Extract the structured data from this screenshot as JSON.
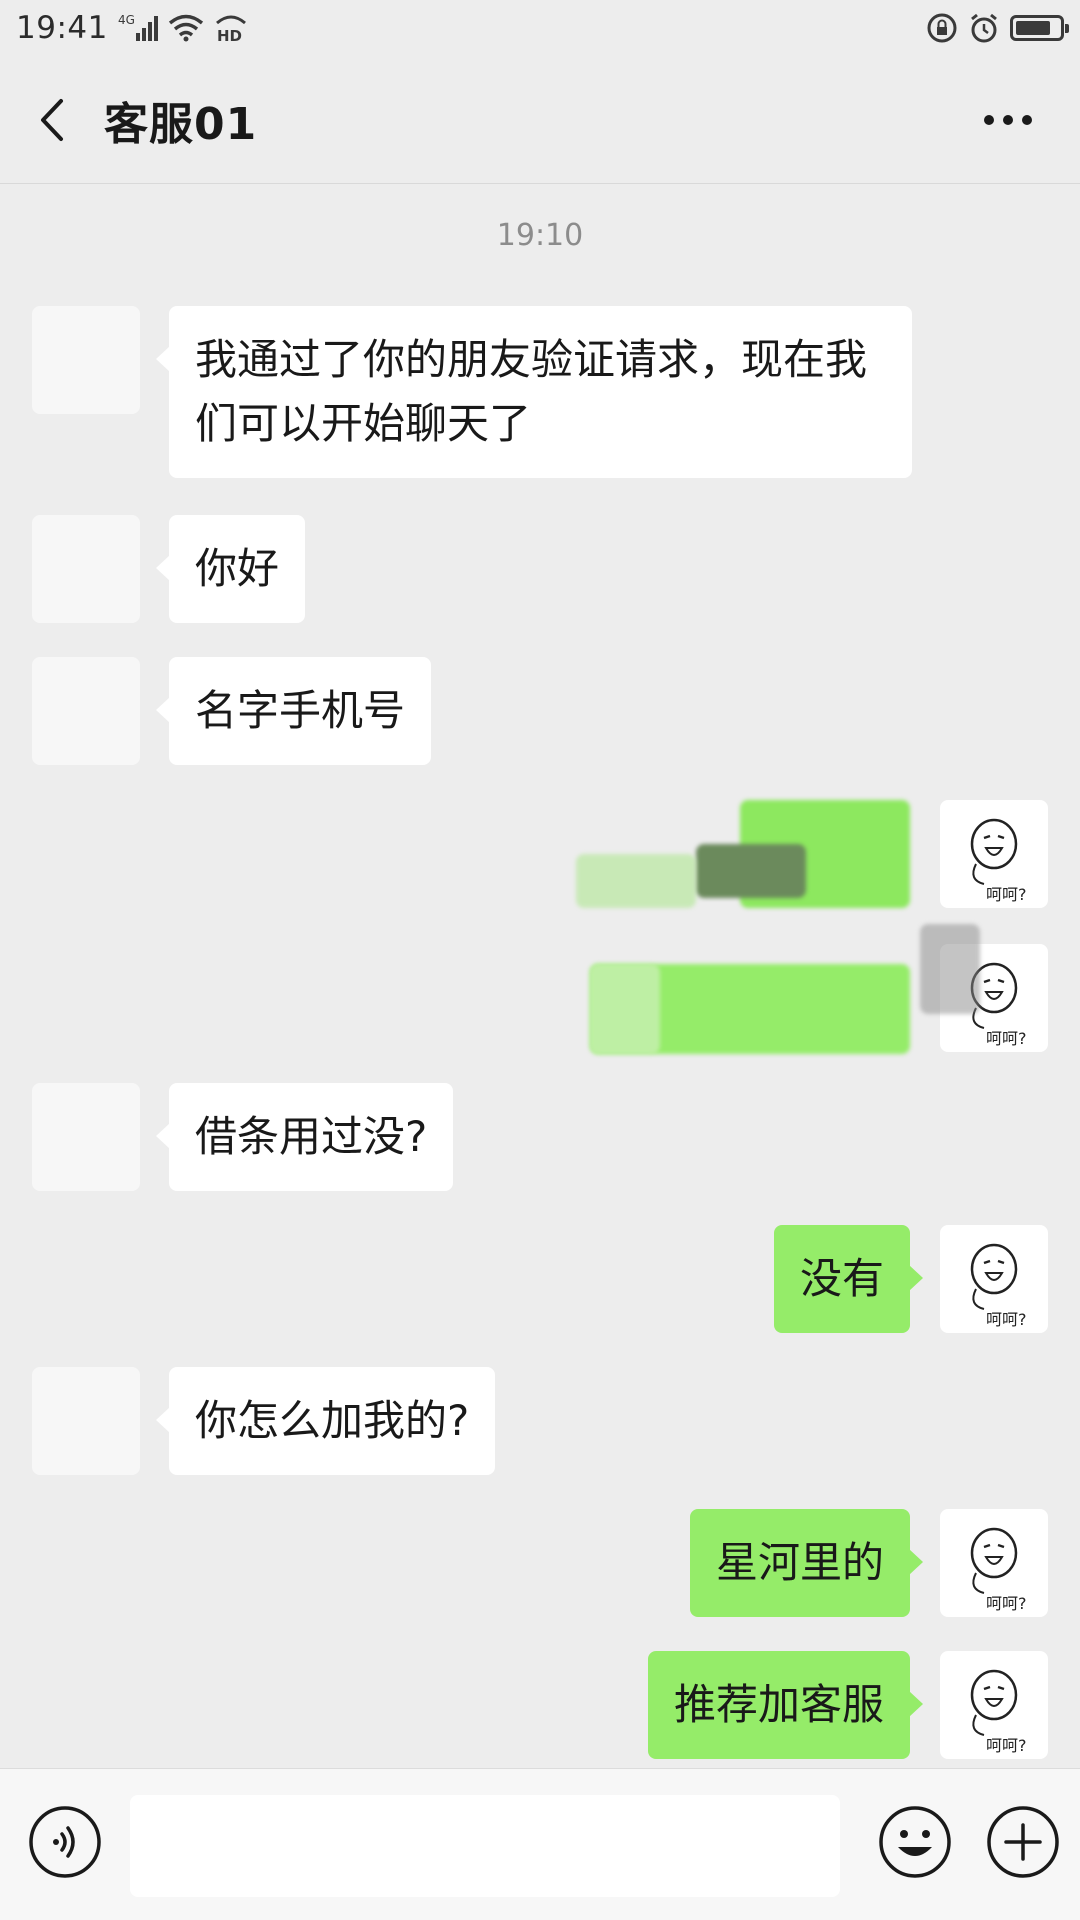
{
  "status_bar": {
    "time": "19:41",
    "network": "4G",
    "hd": "HD"
  },
  "header": {
    "title": "客服01"
  },
  "chat": {
    "timestamp": "19:10",
    "messages": [
      {
        "from": "agent",
        "text": "我通过了你的朋友验证请求，现在我们可以开始聊天了"
      },
      {
        "from": "agent",
        "text": "你好"
      },
      {
        "from": "agent",
        "text": "名字手机号"
      },
      {
        "from": "me",
        "text": ""
      },
      {
        "from": "me",
        "text": ""
      },
      {
        "from": "agent",
        "text": "借条用过没?"
      },
      {
        "from": "me",
        "text": "没有"
      },
      {
        "from": "agent",
        "text": "你怎么加我的?"
      },
      {
        "from": "me",
        "text": "星河里的"
      },
      {
        "from": "me",
        "text": "推荐加客服"
      }
    ],
    "my_avatar_caption": "呵呵?"
  },
  "input": {
    "value": "",
    "placeholder": ""
  },
  "colors": {
    "background": "#ededed",
    "my_bubble": "#95ec69",
    "their_bubble": "#ffffff"
  }
}
